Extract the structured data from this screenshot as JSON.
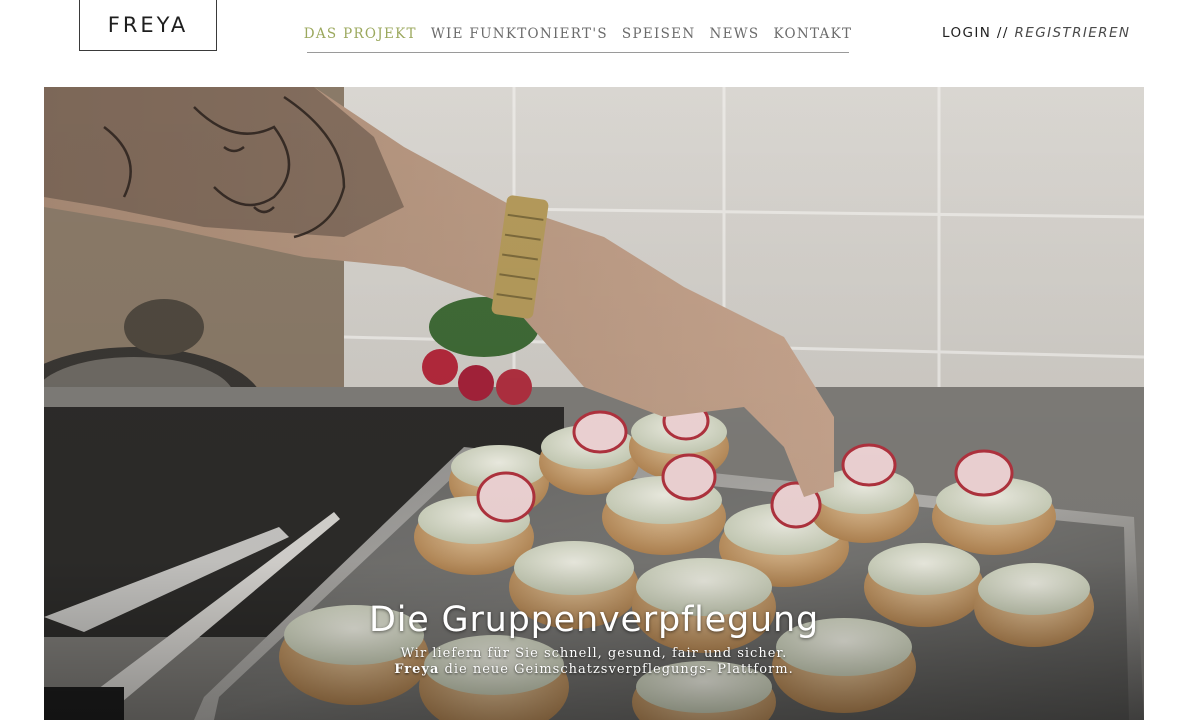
{
  "brand": {
    "logo": "FREYA"
  },
  "nav": {
    "items": [
      {
        "label": "DAS PROJEKT",
        "active": true
      },
      {
        "label": "WIE FUNKTONIERT'S",
        "active": false
      },
      {
        "label": "SPEISEN",
        "active": false
      },
      {
        "label": "NEWS",
        "active": false
      },
      {
        "label": "KONTAKT",
        "active": false
      }
    ],
    "active_color": "#9ba85d"
  },
  "auth": {
    "login": "LOGIN",
    "separator": " // ",
    "register": "REGISTRIEREN"
  },
  "hero": {
    "title": "Die Gruppenverpflegung",
    "line1": "Wir liefern für Sie schnell, gesund, fair und sicher.",
    "line2_brand": "Freya",
    "line2_rest": " die neue Geimschatzsverpflegungs- Plattform."
  }
}
